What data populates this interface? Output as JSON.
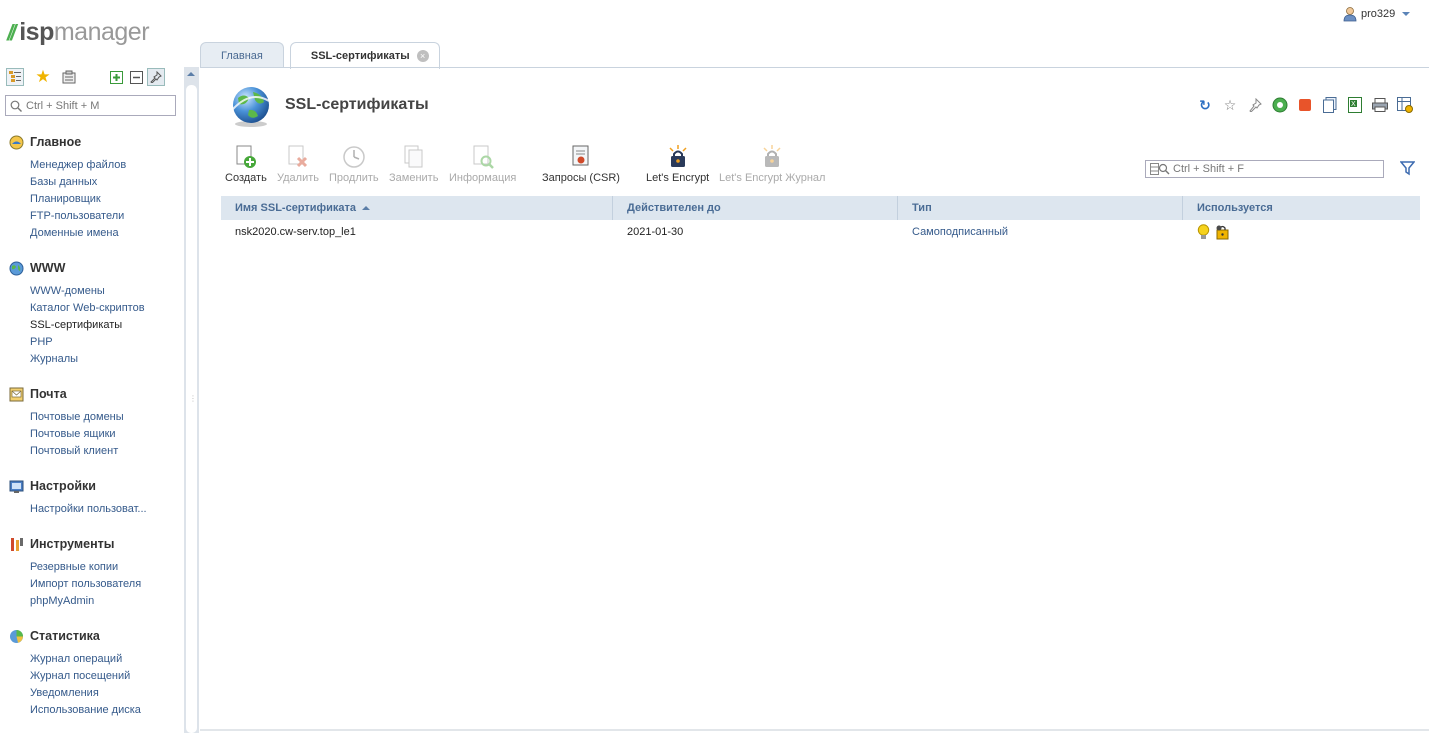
{
  "header": {
    "logo_isp": "isp",
    "logo_manager": "manager",
    "user_name": "pro329"
  },
  "sidebar": {
    "search_placeholder": "Ctrl + Shift + M",
    "groups": [
      {
        "title": "Главное",
        "icon": "home-icon",
        "items": [
          "Менеджер файлов",
          "Базы данных",
          "Планировщик",
          "FTP-пользователи",
          "Доменные имена"
        ]
      },
      {
        "title": "WWW",
        "icon": "globe-icon",
        "items": [
          "WWW-домены",
          "Каталог Web-скриптов",
          "SSL-сертификаты",
          "PHP",
          "Журналы"
        ]
      },
      {
        "title": "Почта",
        "icon": "mail-icon",
        "items": [
          "Почтовые домены",
          "Почтовые ящики",
          "Почтовый клиент"
        ]
      },
      {
        "title": "Настройки",
        "icon": "settings-icon",
        "items": [
          "Настройки пользоват..."
        ]
      },
      {
        "title": "Инструменты",
        "icon": "tools-icon",
        "items": [
          "Резервные копии",
          "Импорт пользователя",
          "phpMyAdmin"
        ]
      },
      {
        "title": "Статистика",
        "icon": "stats-icon",
        "items": [
          "Журнал операций",
          "Журнал посещений",
          "Уведомления",
          "Использование диска"
        ]
      }
    ]
  },
  "tabs": [
    {
      "label": "Главная",
      "active": false
    },
    {
      "label": "SSL-сертификаты",
      "active": true
    }
  ],
  "page": {
    "title": "SSL-сертификаты",
    "filter_placeholder": "Ctrl + Shift + F"
  },
  "toolbar": {
    "create": "Создать",
    "delete": "Удалить",
    "renew": "Продлить",
    "replace": "Заменить",
    "info": "Информация",
    "csr": "Запросы (CSR)",
    "letsencrypt": "Let's Encrypt",
    "letsencrypt_log": "Let's Encrypt Журнал"
  },
  "table": {
    "columns": [
      "Имя SSL-сертификата",
      "Действителен до",
      "Тип",
      "Используется"
    ],
    "rows": [
      {
        "name": "nsk2020.cw-serv.top_le1",
        "valid_until": "2021-01-30",
        "type": "Самоподписанный"
      }
    ]
  },
  "colors": {
    "accent": "#355a8b",
    "header_bg": "#dde6ef",
    "logo_green": "#4caf50"
  }
}
